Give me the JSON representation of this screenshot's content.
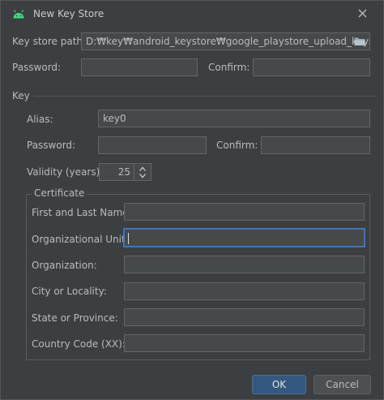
{
  "window": {
    "title": "New Key Store",
    "icon": "android-icon",
    "close_icon": "close-icon"
  },
  "keystore": {
    "path_label": "Key store path:",
    "path_value": "D:\\key\\android_keystore\\google_playstore_upload_keysotre.jks",
    "path_display": "D:₩key₩android_keystore₩google_playstore_upload_keysotre.jks",
    "folder_icon": "folder-icon",
    "password_label": "Password:",
    "confirm_label": "Confirm:"
  },
  "key": {
    "section_label": "Key",
    "alias_label": "Alias:",
    "alias_value": "key0",
    "password_label": "Password:",
    "confirm_label": "Confirm:",
    "validity_label": "Validity (years):",
    "validity_value": "25"
  },
  "certificate": {
    "group_label": "Certificate",
    "fields": [
      {
        "label": "First and Last Name:",
        "value": ""
      },
      {
        "label": "Organizational Unit:",
        "value": ""
      },
      {
        "label": "Organization:",
        "value": ""
      },
      {
        "label": "City or Locality:",
        "value": ""
      },
      {
        "label": "State or Province:",
        "value": ""
      },
      {
        "label": "Country Code (XX):",
        "value": ""
      }
    ]
  },
  "buttons": {
    "ok": "OK",
    "cancel": "Cancel"
  },
  "colors": {
    "background": "#3c3f41",
    "field": "#45494a",
    "focus": "#3d76b8",
    "ok_button": "#365880",
    "android_green": "#3ddc84"
  }
}
